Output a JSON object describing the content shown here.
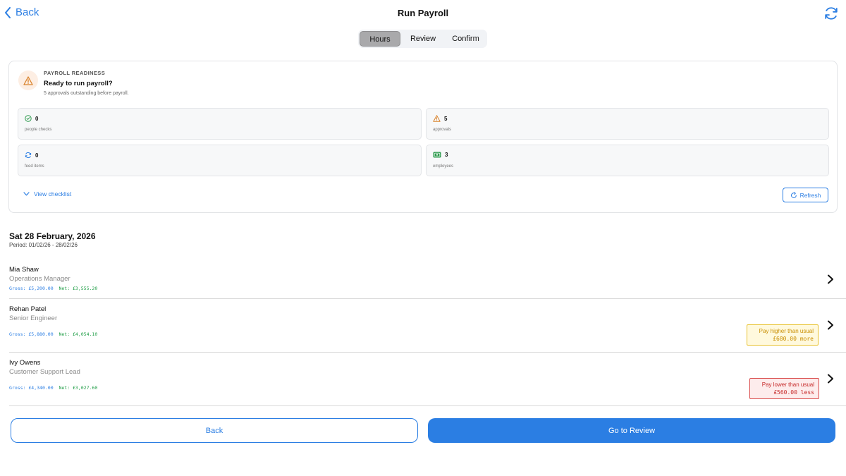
{
  "header": {
    "back_label": "Back",
    "title": "Run Payroll",
    "refresh_icon": "refresh-icon"
  },
  "tabs": [
    {
      "label": "Hours",
      "active": true
    },
    {
      "label": "Review",
      "active": false
    },
    {
      "label": "Confirm",
      "active": false
    }
  ],
  "readiness": {
    "kicker": "PAYROLL READINESS",
    "title": "Ready to run payroll?",
    "subtitle": "5 approvals outstanding before payroll.",
    "stats": [
      {
        "value": "0",
        "label": "people checks",
        "icon": "check-circle-icon"
      },
      {
        "value": "5",
        "label": "approvals",
        "icon": "warning-icon"
      },
      {
        "value": "0",
        "label": "feed items",
        "icon": "sync-icon"
      },
      {
        "value": "3",
        "label": "employees",
        "icon": "money-icon"
      }
    ],
    "checklist_label": "View checklist",
    "refresh_label": "Refresh"
  },
  "payroll": {
    "date": "Sat 28 February, 2026",
    "period": "Period: 01/02/26 - 28/02/26",
    "employees": [
      {
        "name": "Mia Shaw",
        "role": "Operations Manager",
        "gross": "Gross: £5,200.00",
        "net": "Net: £3,555.20",
        "flag": null
      },
      {
        "name": "Rehan Patel",
        "role": "Senior Engineer",
        "gross": "Gross: £5,880.00",
        "net": "Net: £4,054.10",
        "flag": {
          "type": "high",
          "title": "Pay higher than usual",
          "amount": "£680.00 more"
        }
      },
      {
        "name": "Ivy Owens",
        "role": "Customer Support Lead",
        "gross": "Gross: £4,340.00",
        "net": "Net: £3,027.60",
        "flag": {
          "type": "low",
          "title": "Pay lower than usual",
          "amount": "£560.00 less"
        }
      }
    ]
  },
  "footer": {
    "back_label": "Back",
    "next_label": "Go to Review"
  },
  "colors": {
    "accent": "#2b7ee3",
    "net_green": "#1f9d46",
    "warning_amber": "#c98e00",
    "danger_red": "#c62828"
  }
}
